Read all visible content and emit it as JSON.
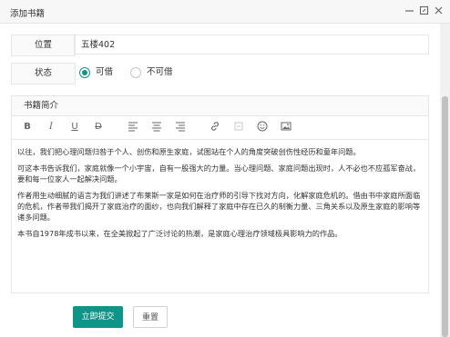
{
  "window": {
    "title": "添加书籍",
    "controls": [
      "minimize-icon",
      "maximize-icon",
      "close-icon"
    ]
  },
  "form": {
    "location": {
      "label": "位置",
      "value": "五楼402"
    },
    "status": {
      "label": "状态",
      "options": [
        {
          "label": "可借",
          "selected": true
        },
        {
          "label": "不可借",
          "selected": false
        }
      ]
    },
    "description": {
      "label": "书籍简介",
      "toolbar": [
        "bold-icon",
        "italic-icon",
        "underline-icon",
        "strikethrough-icon",
        "align-left-icon",
        "align-center-icon",
        "align-right-icon",
        "link-icon",
        "unlink-icon",
        "emoji-icon",
        "image-icon"
      ],
      "paragraphs": [
        "以往，我们把心理问题归咎于个人、创伤和原生家庭，试图站在个人的角度突破创伤性经历和童年问题。",
        "可这本书告诉我们，家庭就像一个小宇宙，自有一股强大的力量。当心理问题、家庭问题出现时，人不必也不应孤军奋战，要和每一位家人一起解决问题。",
        "作者用生动细腻的语言为我们讲述了布莱斯一家是如何在治疗师的引导下找对方向，化解家庭危机的。借由书中家庭所面临的危机，作者带我们揭开了家庭治疗的面纱，也向我们解释了家庭中存在已久的制衡力量、三角关系以及原生家庭的影响等诸多问题。",
        "本书自1978年成书以来，在全美掀起了广泛讨论的热潮，是家庭心理治疗领域极具影响力的作品。"
      ]
    },
    "buttons": {
      "submit": "立即提交",
      "reset": "重置"
    }
  },
  "colors": {
    "accent": "#0f9488"
  }
}
